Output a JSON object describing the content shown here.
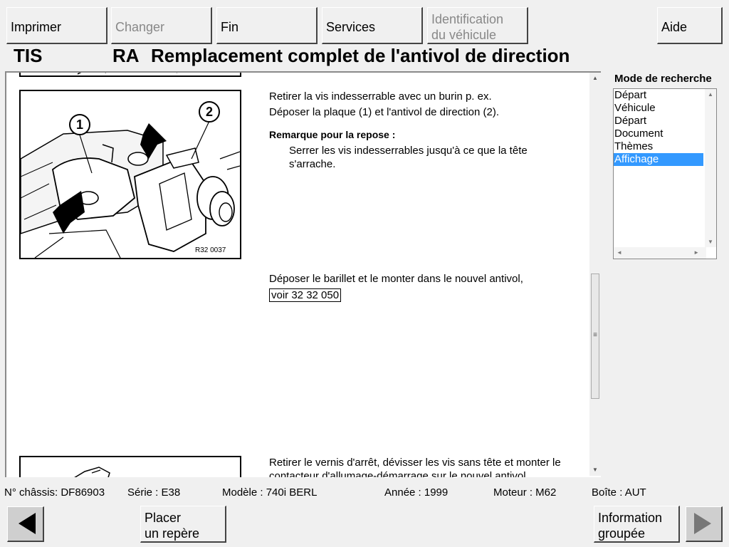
{
  "toolbar": {
    "print": "Imprimer",
    "change": "Changer",
    "end": "Fin",
    "services": "Services",
    "vehicle_id_line1": "Identification",
    "vehicle_id_line2": "du véhicule",
    "help": "Aide"
  },
  "header": {
    "app": "TIS",
    "doc_type": "RA",
    "title": "Remplacement complet de l'antivol de direction"
  },
  "document": {
    "step1_line1": "Retirer la vis indesserrable avec un burin p. ex.",
    "step1_line2": "Déposer la plaque (1) et l'antivol de direction (2).",
    "note_heading": "Remarque pour la repose :",
    "note_line1": "Serrer les vis indesserrables jusqu'à ce que la tête",
    "note_line2": "s'arrache.",
    "figure_label": "R32 0037",
    "callout_1": "1",
    "callout_2": "2",
    "step2_line1": "Déposer le barillet et le monter dans le nouvel antivol,",
    "step2_link": "voir 32 32 050",
    "step3_line1": "Retirer le vernis d'arrêt, dévisser les vis sans tête et monter le",
    "step3_line2": "contacteur d'allumage-démarrage sur le nouvel antivol."
  },
  "search_mode": {
    "label": "Mode de recherche",
    "items": [
      "Départ",
      "Véhicule",
      "Départ",
      "Document",
      "Thèmes",
      "Affichage"
    ],
    "selected_index": 5
  },
  "status": {
    "chassis": "N° châssis: DF86903",
    "series": "Série : E38",
    "model": "Modèle : 740i BERL",
    "year": "Année : 1999",
    "engine": "Moteur : M62",
    "gearbox": "Boîte : AUT"
  },
  "bottom": {
    "bookmark_line1": "Placer",
    "bookmark_line2": "un repère",
    "grouped_line1": "Information",
    "grouped_line2": "groupée"
  },
  "icons": {
    "prev": "triangle-left-icon",
    "next": "triangle-right-icon"
  }
}
